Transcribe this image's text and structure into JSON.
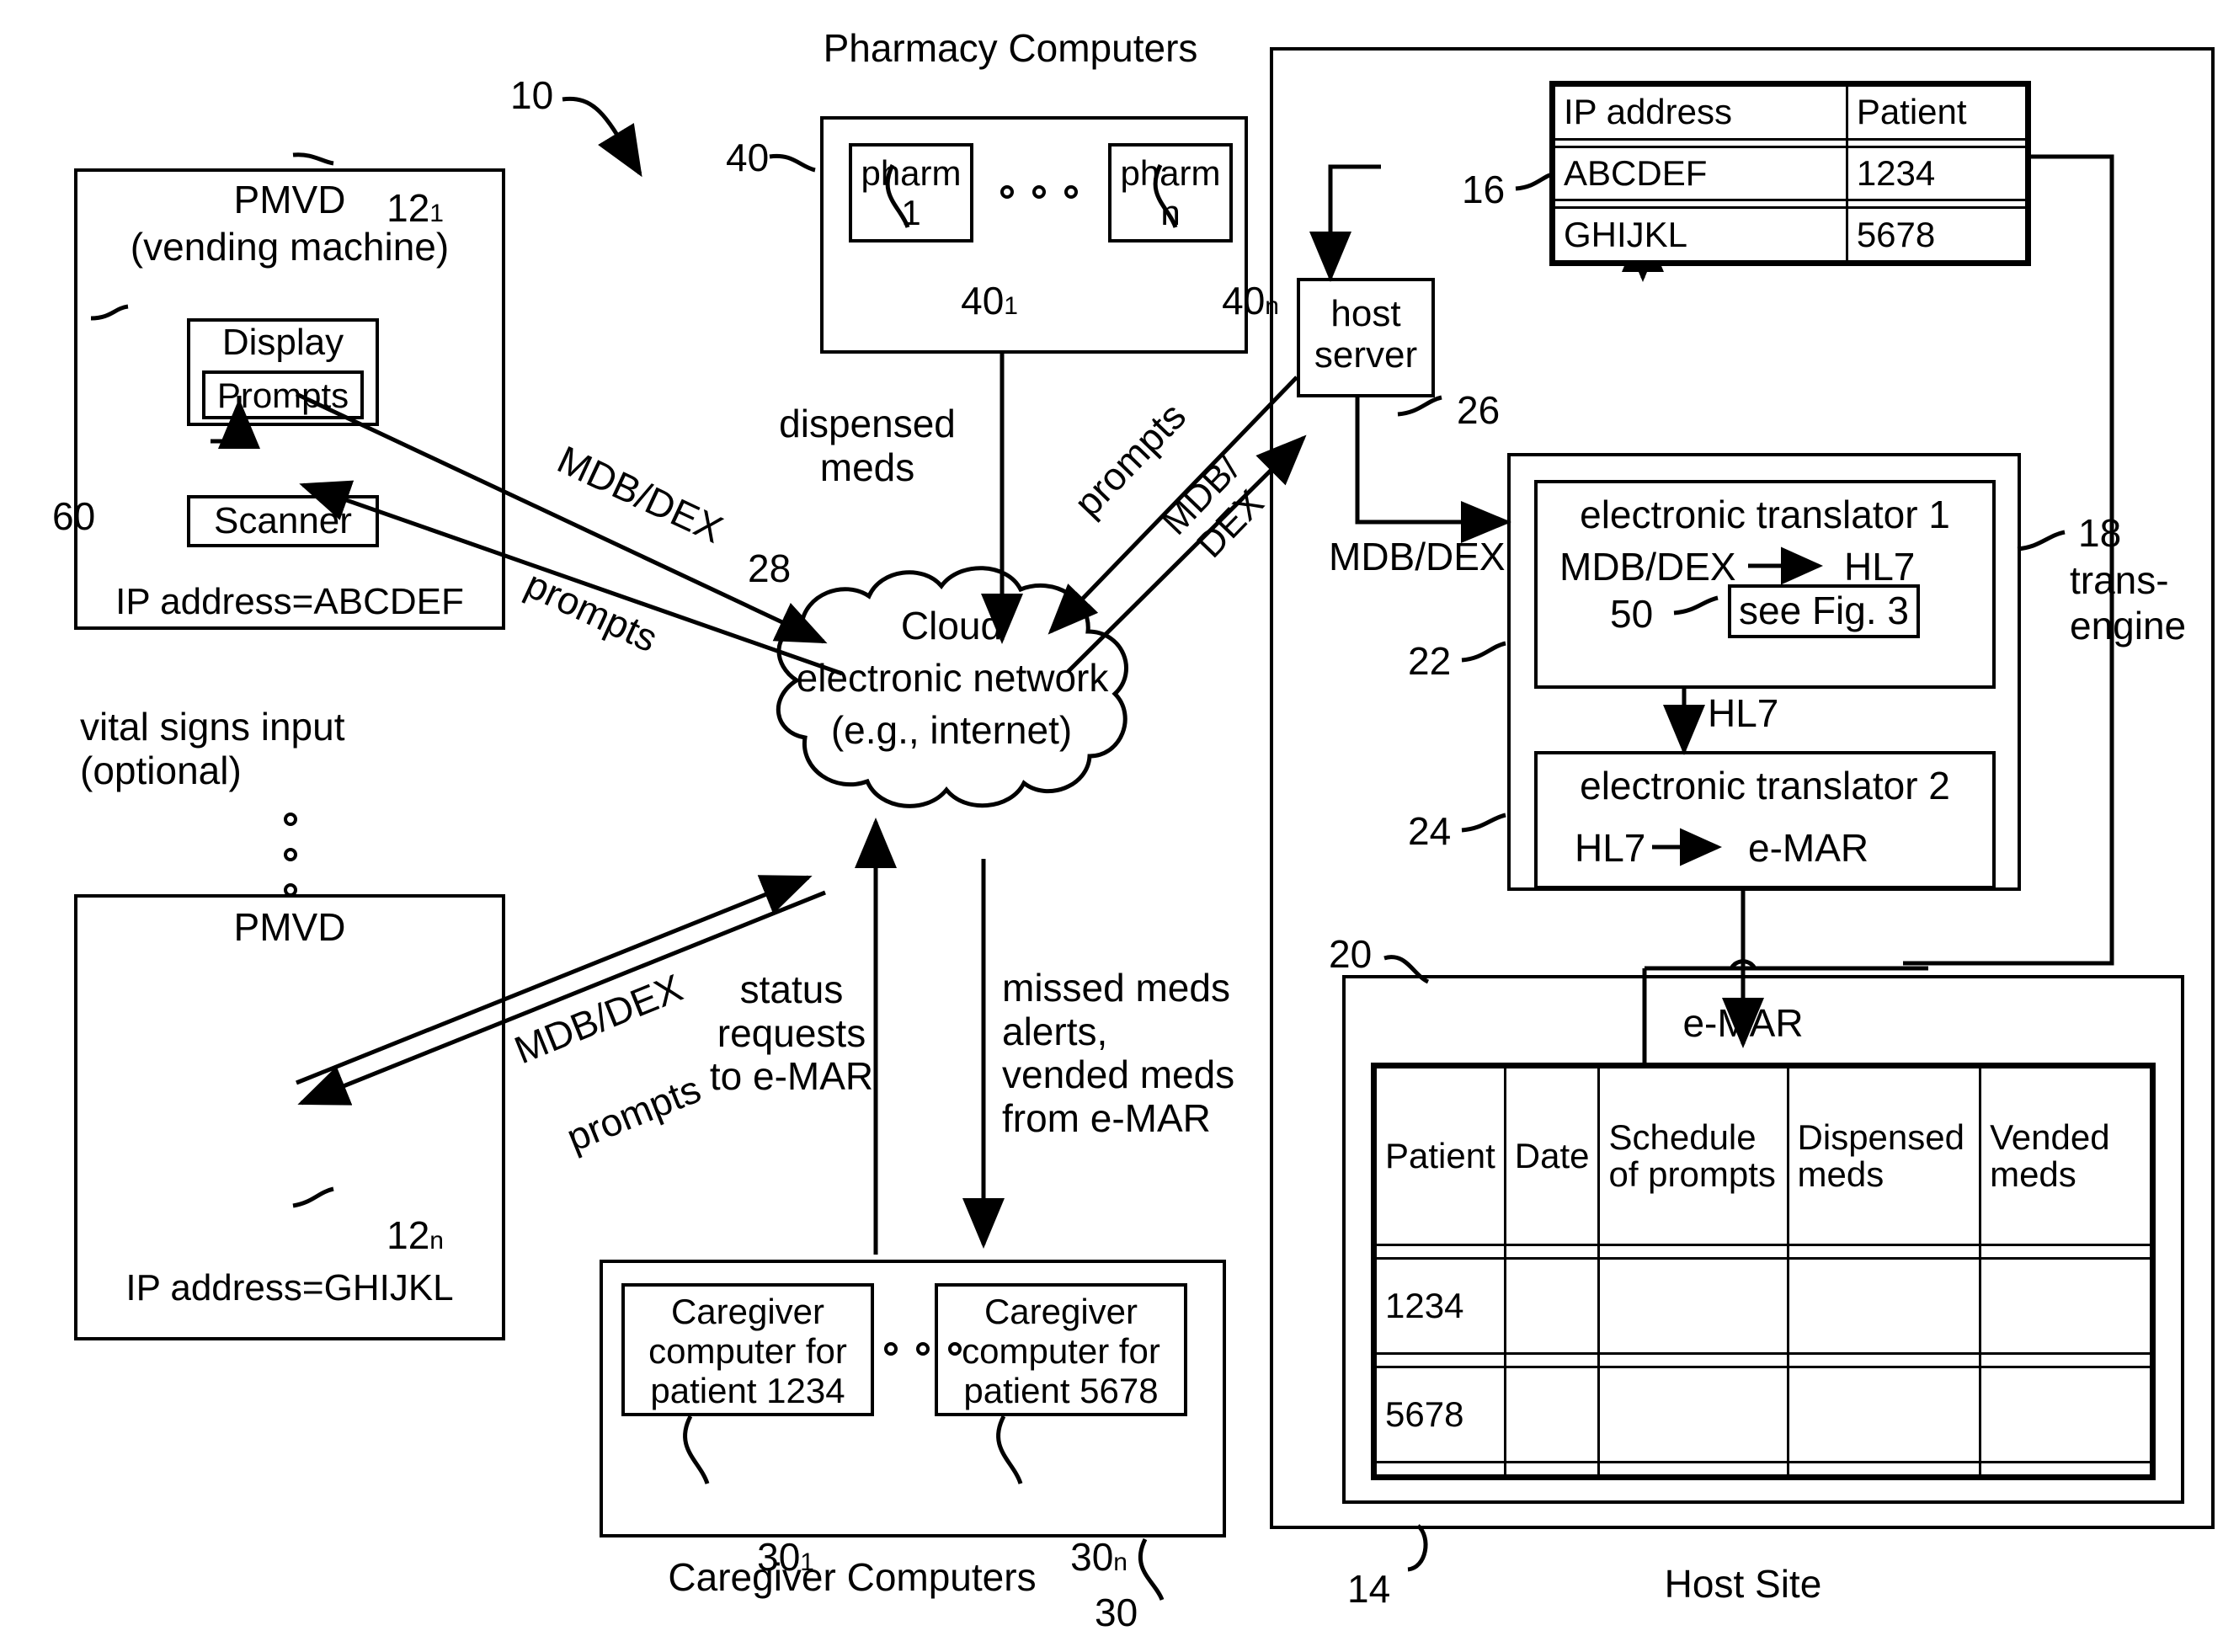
{
  "figure": {
    "ref_system": "10",
    "ref_host_site": "14",
    "host_site_label": "Host Site",
    "ref_pmvd_1": "12",
    "ref_pmvd_1_sub": "1",
    "ref_pmvd_n": "12",
    "ref_pmvd_n_sub": "n",
    "ref_scanner": "60",
    "ref_cloud": "28",
    "ref_ip_table": "16",
    "ref_host_server": "26",
    "ref_trans_engine": "18",
    "trans_engine_label_1": "trans-",
    "trans_engine_label_2": "engine",
    "ref_translator1": "22",
    "ref_translator2": "24",
    "ref_see_fig": "50",
    "ref_emar_box": "20",
    "ref_pharmacy": "40",
    "ref_pharm_1": "40",
    "ref_pharm_1_sub": "1",
    "ref_pharm_n": "40",
    "ref_pharm_n_sub": "n",
    "ref_caregivers": "30",
    "ref_caregiver_1": "30",
    "ref_caregiver_1_sub": "1",
    "ref_caregiver_n": "30",
    "ref_caregiver_n_sub": "n"
  },
  "pmvd_1": {
    "title": "PMVD",
    "subtitle": "(vending machine)",
    "display_label": "Display",
    "prompts_label": "Prompts",
    "scanner_label": "Scanner",
    "ip_label": "IP address=ABCDEF"
  },
  "pmvd_n": {
    "title": "PMVD",
    "ip_label": "IP address=GHIJKL"
  },
  "vital_signs": {
    "line1": "vital signs input",
    "line2": "(optional)"
  },
  "cloud": {
    "line1": "Cloud",
    "line2": "electronic network",
    "line3": "(e.g., internet)"
  },
  "pharmacy": {
    "heading": "Pharmacy Computers",
    "computer_first": "pharm\n1",
    "computer_last": "pharm\nn"
  },
  "caregivers": {
    "heading": "Caregiver Computers",
    "computer_first": "Caregiver\ncomputer for\npatient 1234",
    "computer_last": "Caregiver\ncomputer for\npatient 5678"
  },
  "host": {
    "server_label": "host\nserver",
    "mdb_dex_label": "MDB/DEX",
    "hl7_label": "HL7",
    "emar_label": "e-MAR"
  },
  "translator1": {
    "title": "electronic translator 1",
    "from": "MDB/DEX",
    "to": "HL7",
    "see_fig": "see Fig. 3"
  },
  "translator2": {
    "title": "electronic translator 2",
    "from": "HL7",
    "to": "e-MAR"
  },
  "ip_table": {
    "headers": [
      "IP address",
      "Patient"
    ],
    "rows": [
      [
        "",
        ""
      ],
      [
        "ABCDEF",
        "1234"
      ],
      [
        "",
        ""
      ],
      [
        "GHIJKL",
        "5678"
      ]
    ]
  },
  "emar_table": {
    "headers": [
      "Patient",
      "Date",
      "Schedule\nof prompts",
      "Dispensed\nmeds",
      "Vended\nmeds"
    ],
    "rows": [
      [
        "",
        "",
        "",
        "",
        ""
      ],
      [
        "1234",
        "",
        "",
        "",
        ""
      ],
      [
        "",
        "",
        "",
        "",
        ""
      ],
      [
        "5678",
        "",
        "",
        "",
        ""
      ],
      [
        "",
        "",
        "",
        "",
        ""
      ]
    ]
  },
  "arrow_labels": {
    "mdb_dex_top": "MDB/DEX",
    "prompts_top": "prompts",
    "mdb_dex_bottom": "MDB/DEX",
    "prompts_bottom": "prompts",
    "dispensed_meds": "dispensed\nmeds",
    "prompts_right": "prompts",
    "mdb_dex_right": "MDB/\nDEX",
    "status_requests": "status\nrequests\nto e-MAR",
    "missed_meds": "missed meds\nalerts,\nvended meds\nfrom e-MAR"
  }
}
